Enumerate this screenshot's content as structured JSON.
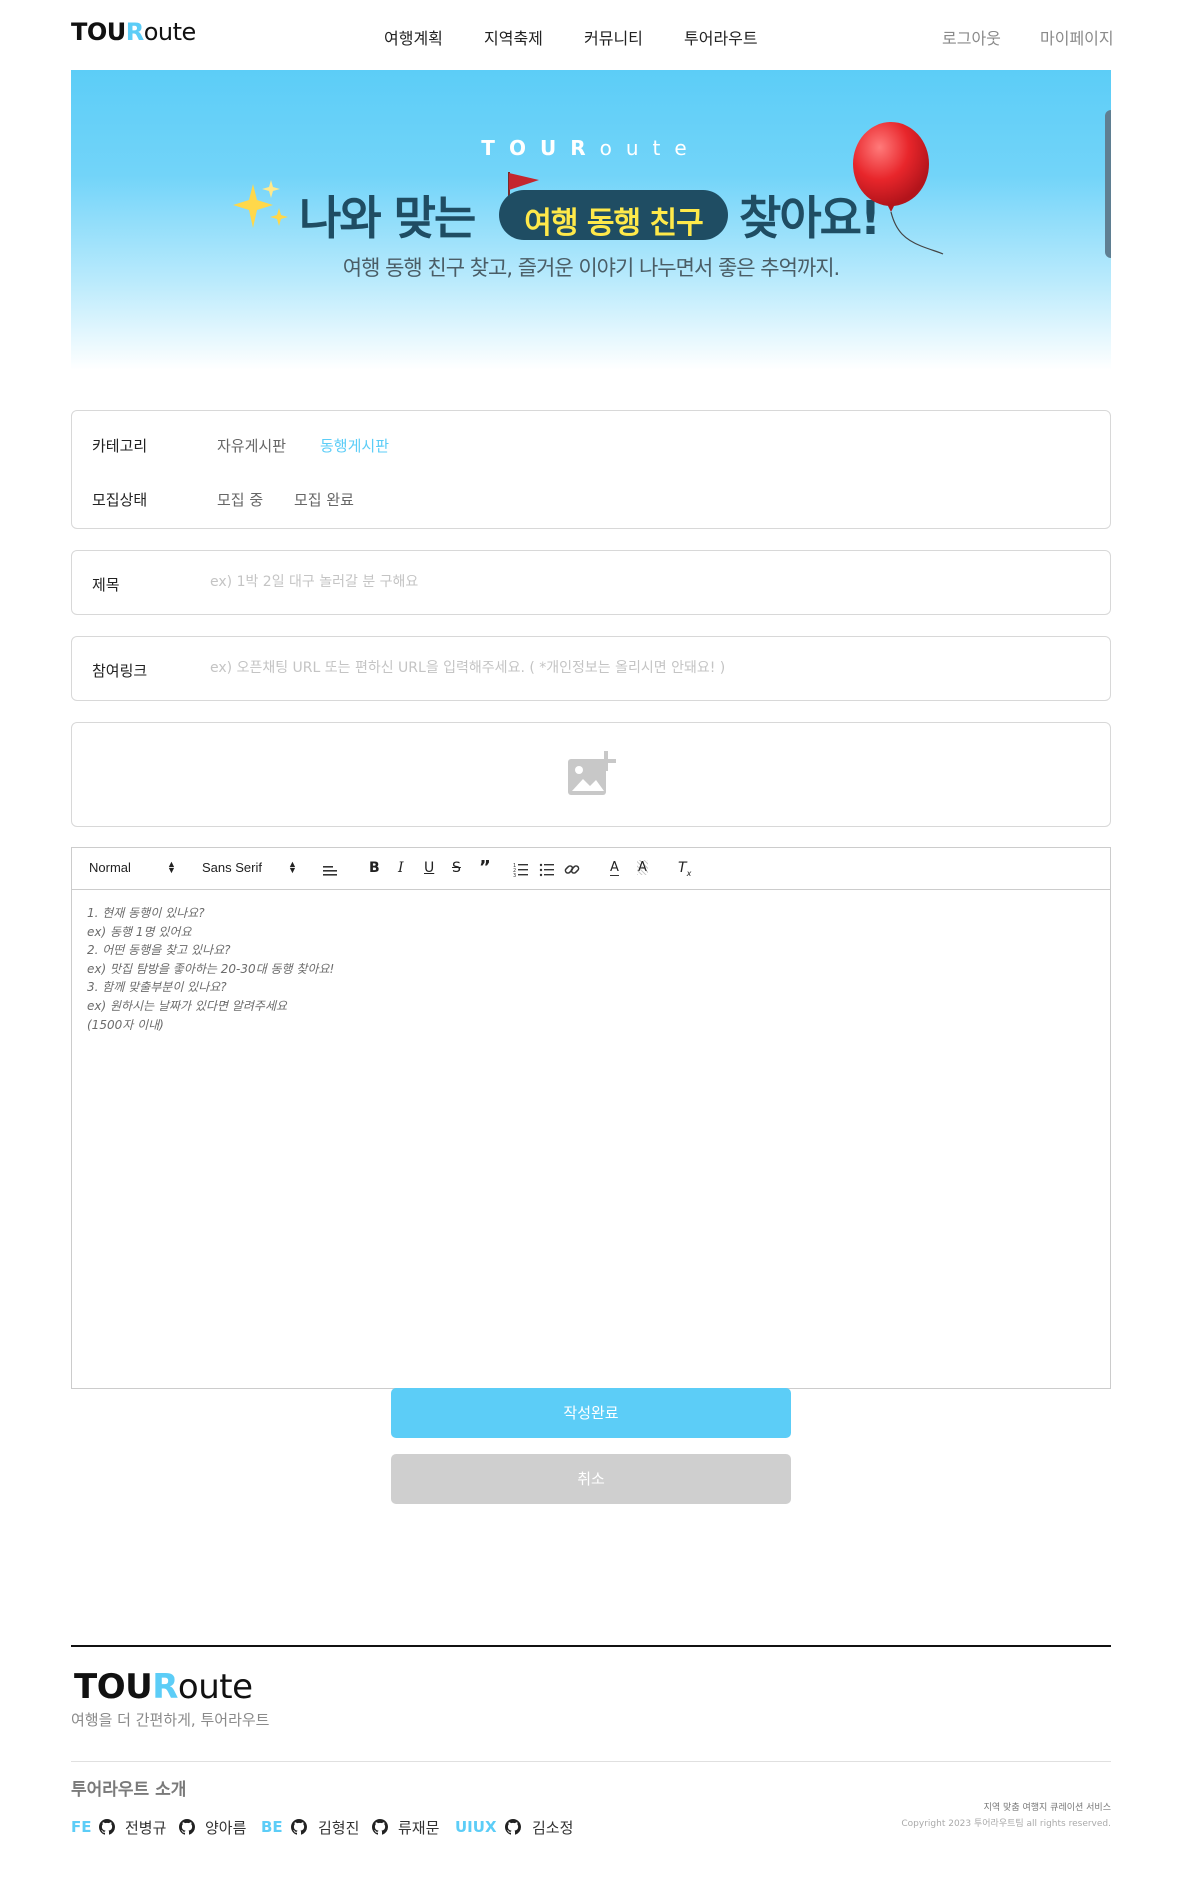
{
  "header": {
    "logo": {
      "bold": "TOU",
      "accent": "R",
      "light": "oute"
    },
    "nav": [
      "여행계획",
      "지역축제",
      "커뮤니티",
      "투어라우트"
    ],
    "logout": "로그아웃",
    "mypage": "마이페이지"
  },
  "banner": {
    "brand_spaced": [
      "T",
      "O",
      "U",
      "R",
      "o",
      "u",
      "t",
      "e"
    ],
    "headline_left": "나와 맞는",
    "headline_pill": "여행 동행 친구",
    "headline_right": "찾아요!",
    "subheadline": "여행 동행 친구 찾고, 즐거운 이야기 나누면서 좋은 추억까지.",
    "colors": {
      "sky": "#5ccdf7",
      "navy": "#1f4d63",
      "yellow": "#ffe94a",
      "balloon": "#e8262b"
    }
  },
  "form": {
    "category_label": "카테고리",
    "category_options": [
      "자유게시판",
      "동행게시판"
    ],
    "category_selected": "동행게시판",
    "status_label": "모집상태",
    "status_options": [
      "모집 중",
      "모집 완료"
    ],
    "title_label": "제목",
    "title_placeholder": "ex) 1박 2일 대구 놀러갈 분 구해요",
    "link_label": "참여링크",
    "link_placeholder": "ex) 오픈채팅 URL 또는 편하신 URL을 입력해주세요. ( *개인정보는 올리시면 안돼요! )",
    "image_upload_icon": "add-photo-icon"
  },
  "editor": {
    "header_select": "Normal",
    "font_select": "Sans Serif",
    "placeholder_lines": [
      "1. 현재 동행이 있나요?",
      "ex) 동행 1명 있어요",
      "2. 어떤 동행을 찾고 있나요?",
      "ex) 맛집  탐방을 좋아하는 20-30대 동행 찾아요!",
      "3. 함께 맞출부분이 있나요?",
      "ex) 원하시는 날짜가 있다면 알려주세요",
      "(1500자 이내)"
    ]
  },
  "buttons": {
    "submit": "작성완료",
    "cancel": "취소"
  },
  "footer": {
    "logo": {
      "bold": "TOU",
      "accent": "R",
      "light": "oute"
    },
    "tagline": "여행을 더 간편하게, 투어라우트",
    "about": "투어라우트 소개",
    "teams": [
      {
        "role": "FE",
        "members": [
          "전병규",
          "양아름"
        ]
      },
      {
        "role": "BE",
        "members": [
          "김형진",
          "류재문"
        ]
      },
      {
        "role": "UIUX",
        "members": [
          "김소정"
        ]
      }
    ],
    "service_desc": "지역 맞춤 여행지 큐레이션 서비스",
    "copyright": "Copyright 2023 투어라우트팀 all rights reserved."
  }
}
